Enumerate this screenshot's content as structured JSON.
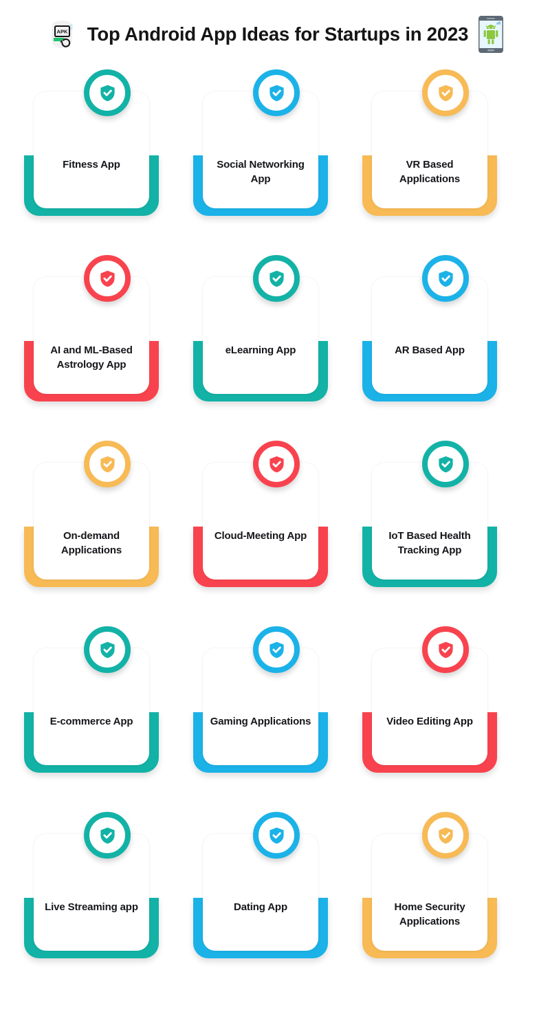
{
  "header": {
    "title": "Top Android App Ideas for Startups in 2023",
    "left_icon": "apk-logo-icon",
    "right_icon": "android-phone-icon"
  },
  "colors": {
    "teal": "#13B2A6",
    "blue": "#1BB2E8",
    "orange": "#F7BA55",
    "red": "#F8434E",
    "text": "#15161A",
    "background": "#FFFFFF"
  },
  "badge_icon": "shield-check-icon",
  "cards": [
    {
      "label": "Fitness App",
      "color": "#13B2A6",
      "color_name": "teal"
    },
    {
      "label": "Social Networking App",
      "color": "#1BB2E8",
      "color_name": "blue"
    },
    {
      "label": "VR Based Applications",
      "color": "#F7BA55",
      "color_name": "orange"
    },
    {
      "label": "AI and ML-Based Astrology App",
      "color": "#F8434E",
      "color_name": "red"
    },
    {
      "label": "eLearning App",
      "color": "#13B2A6",
      "color_name": "teal"
    },
    {
      "label": "AR Based App",
      "color": "#1BB2E8",
      "color_name": "blue"
    },
    {
      "label": "On-demand Applications",
      "color": "#F7BA55",
      "color_name": "orange"
    },
    {
      "label": "Cloud-Meeting App",
      "color": "#F8434E",
      "color_name": "red"
    },
    {
      "label": "IoT Based Health Tracking App",
      "color": "#13B2A6",
      "color_name": "teal"
    },
    {
      "label": "E-commerce App",
      "color": "#13B2A6",
      "color_name": "teal"
    },
    {
      "label": "Gaming Applications",
      "color": "#1BB2E8",
      "color_name": "blue"
    },
    {
      "label": "Video Editing App",
      "color": "#F8434E",
      "color_name": "red"
    },
    {
      "label": "Live Streaming app",
      "color": "#13B2A6",
      "color_name": "teal"
    },
    {
      "label": "Dating App",
      "color": "#1BB2E8",
      "color_name": "blue"
    },
    {
      "label": "Home Security Applications",
      "color": "#F7BA55",
      "color_name": "orange"
    }
  ]
}
